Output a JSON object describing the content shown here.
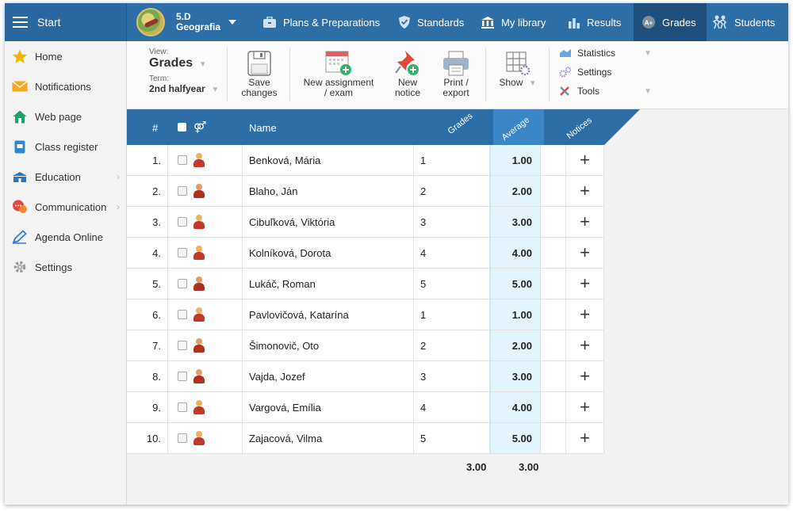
{
  "topbar": {
    "start_label": "Start",
    "class_name": "5.D",
    "class_subject": "Geografia",
    "nav": [
      {
        "label": "Plans & Preparations",
        "icon": "briefcase-icon"
      },
      {
        "label": "Standards",
        "icon": "shield-icon"
      },
      {
        "label": "My library",
        "icon": "library-icon"
      },
      {
        "label": "Results",
        "icon": "bar-chart-icon"
      },
      {
        "label": "Grades",
        "icon": "grades-icon"
      },
      {
        "label": "Students",
        "icon": "students-icon"
      }
    ]
  },
  "sidebar": {
    "items": [
      {
        "label": "Home",
        "icon": "star-icon"
      },
      {
        "label": "Notifications",
        "icon": "envelope-icon"
      },
      {
        "label": "Web page",
        "icon": "house-icon"
      },
      {
        "label": "Class register",
        "icon": "register-icon"
      },
      {
        "label": "Education",
        "icon": "school-icon"
      },
      {
        "label": "Communication",
        "icon": "chat-icon"
      },
      {
        "label": "Agenda Online",
        "icon": "pen-icon"
      },
      {
        "label": "Settings",
        "icon": "gear-icon"
      }
    ]
  },
  "toolbar": {
    "view_label": "View:",
    "view_value": "Grades",
    "term_label": "Term:",
    "term_value": "2nd halfyear",
    "save_line1": "Save",
    "save_line2": "changes",
    "new_assign_line1": "New assignment",
    "new_assign_line2": "/ exam",
    "new_notice_line1": "New",
    "new_notice_line2": "notice",
    "print_line1": "Print /",
    "print_line2": "export",
    "show_label": "Show",
    "statistics_label": "Statistics",
    "settings_label": "Settings",
    "tools_label": "Tools"
  },
  "table": {
    "headers": {
      "num": "#",
      "name": "Name",
      "grades": "Grades",
      "average": "Average",
      "notices": "Notices"
    },
    "rows": [
      {
        "num": "1.",
        "name": "Benková, Mária",
        "grade": "1",
        "avg": "1.00",
        "gender": "f"
      },
      {
        "num": "2.",
        "name": "Blaho, Ján",
        "grade": "2",
        "avg": "2.00",
        "gender": "m"
      },
      {
        "num": "3.",
        "name": "Cibuľková, Viktória",
        "grade": "3",
        "avg": "3.00",
        "gender": "f"
      },
      {
        "num": "4.",
        "name": "Kolníková, Dorota",
        "grade": "4",
        "avg": "4.00",
        "gender": "f"
      },
      {
        "num": "5.",
        "name": "Lukáč, Roman",
        "grade": "5",
        "avg": "5.00",
        "gender": "m"
      },
      {
        "num": "6.",
        "name": "Pavlovičová, Katarína",
        "grade": "1",
        "avg": "1.00",
        "gender": "f"
      },
      {
        "num": "7.",
        "name": "Šimonovič, Oto",
        "grade": "2",
        "avg": "2.00",
        "gender": "m"
      },
      {
        "num": "8.",
        "name": "Vajda, Jozef",
        "grade": "3",
        "avg": "3.00",
        "gender": "m"
      },
      {
        "num": "9.",
        "name": "Vargová, Emília",
        "grade": "4",
        "avg": "4.00",
        "gender": "f"
      },
      {
        "num": "10.",
        "name": "Zajacová, Vilma",
        "grade": "5",
        "avg": "5.00",
        "gender": "f"
      }
    ],
    "totals": {
      "grades_avg": "3.00",
      "average_avg": "3.00"
    }
  },
  "colors": {
    "nav_bg": "#2e6ea6",
    "nav_active": "#1f4f7d",
    "average_col": "#e4f4fc"
  }
}
